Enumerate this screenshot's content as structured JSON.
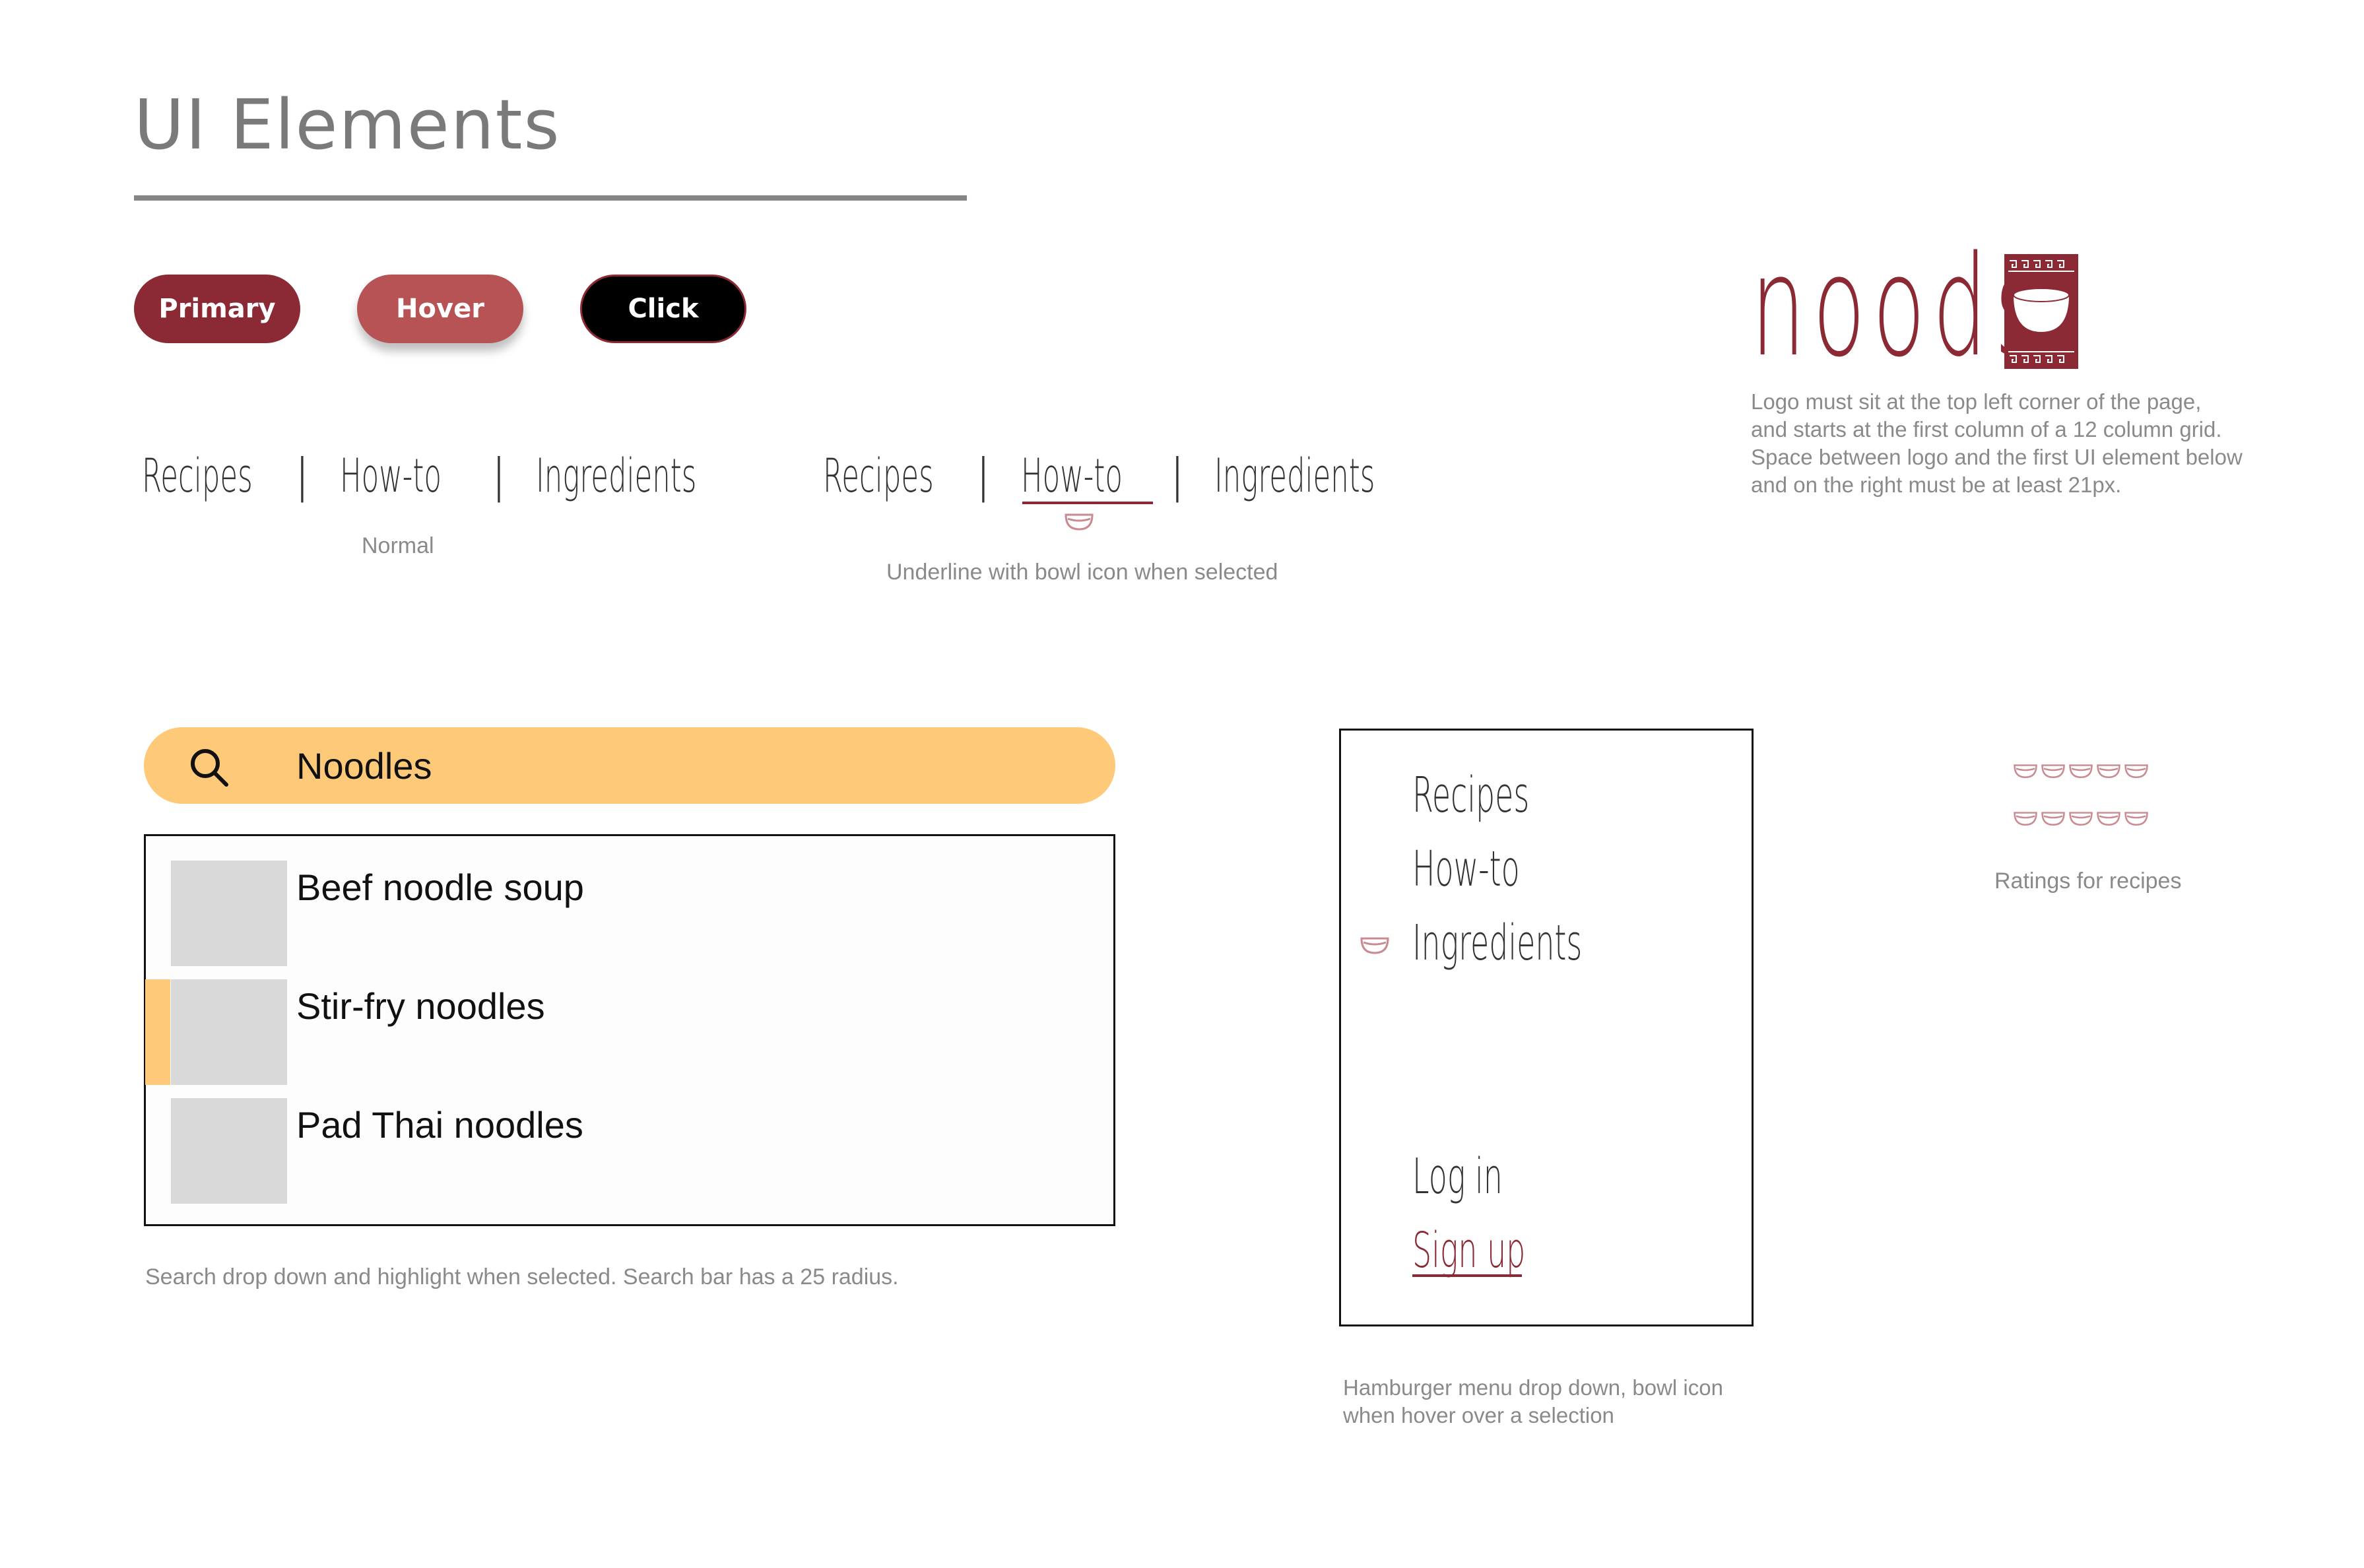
{
  "header": {
    "title": "UI Elements"
  },
  "buttons": {
    "primary": "Primary",
    "hover": "Hover",
    "click": "Click"
  },
  "nav_normal": {
    "items": [
      "Recipes",
      "How-to",
      "Ingredients"
    ],
    "separator": "|",
    "caption": "Normal"
  },
  "nav_selected": {
    "items": [
      "Recipes",
      "How-to",
      "Ingredients"
    ],
    "separator": "|",
    "selected": "How-to",
    "caption": "Underline with bowl icon when selected"
  },
  "logo": {
    "text": "noods",
    "caption_lines": [
      "Logo must sit at the top left corner of the page,",
      "and starts at the first column of a 12 column grid.",
      "Space between logo and the first UI element below",
      "and on the right must be at least 21px."
    ],
    "brand_color": "#8b2a35"
  },
  "search": {
    "query": "Noodles",
    "icon": "search-icon",
    "results": [
      "Beef noodle soup",
      "Stir-fry noodles",
      "Pad Thai noodles"
    ],
    "highlighted_index": 1,
    "caption": "Search drop down and highlight when selected. Search bar has a 25 radius.",
    "accent": "#ffc97a"
  },
  "hamburger": {
    "items": [
      "Recipes",
      "How-to",
      "Ingredients"
    ],
    "hovered": "Ingredients",
    "login": "Log in",
    "signup": "Sign up",
    "caption_lines": [
      "Hamburger menu drop down, bowl icon",
      "when hover over a selection"
    ]
  },
  "ratings": {
    "rows": 2,
    "bowls_per_row": 5,
    "caption": "Ratings for recipes"
  }
}
